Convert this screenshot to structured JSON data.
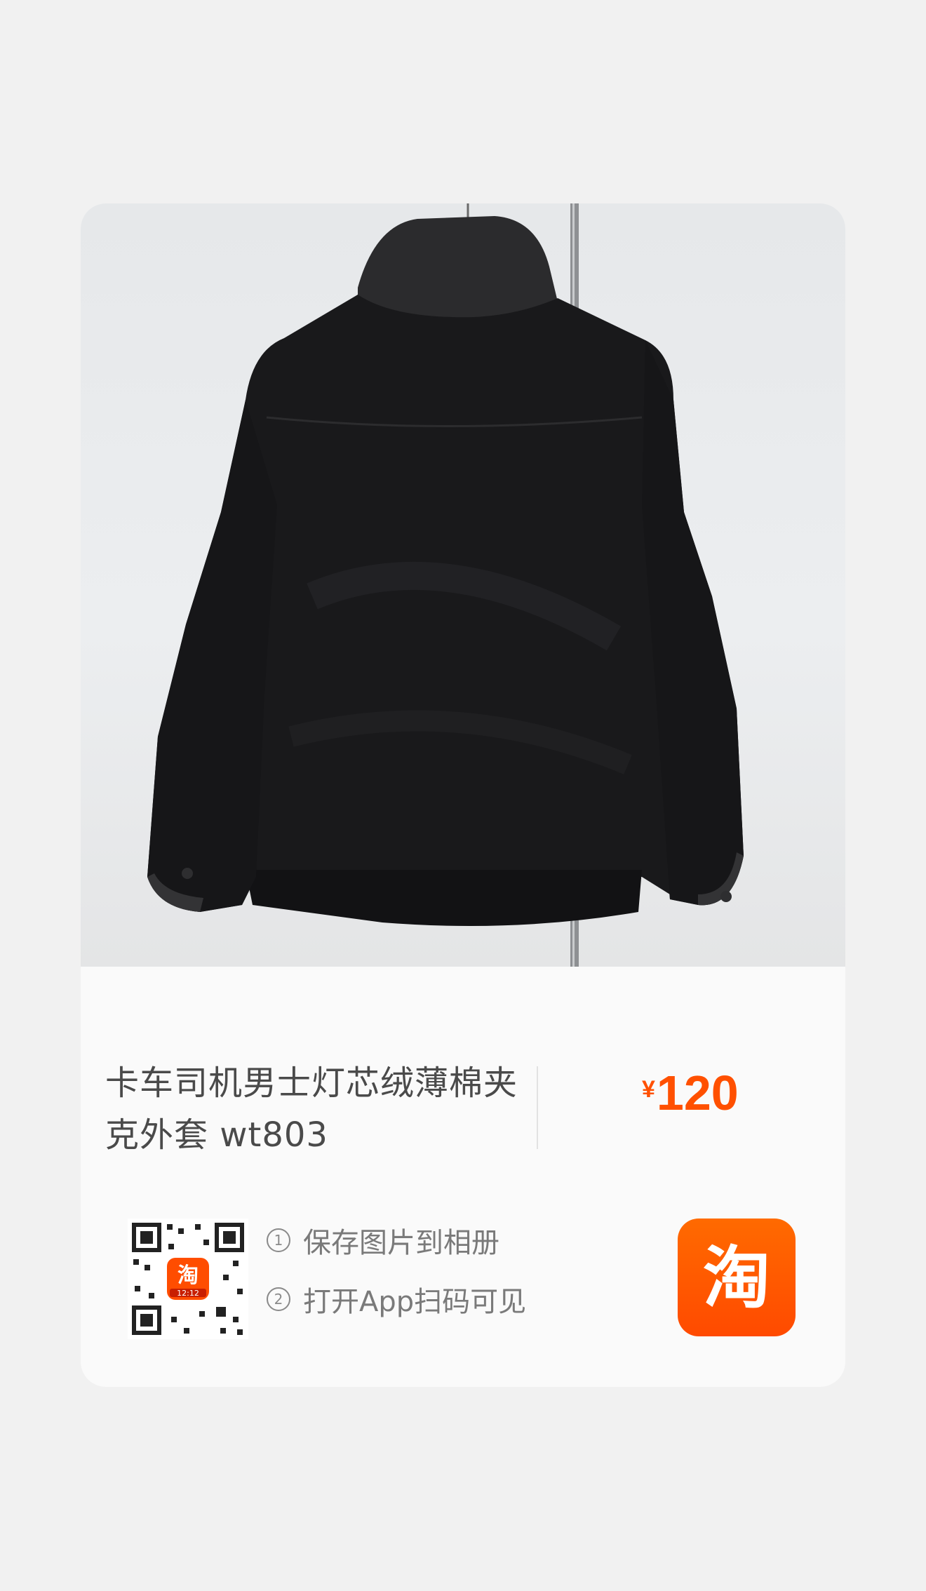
{
  "product": {
    "title": "卡车司机男士灯芯绒薄棉夹克外套 wt803",
    "currency": "¥",
    "price": "120"
  },
  "steps": [
    {
      "num": "1",
      "text": "保存图片到相册"
    },
    {
      "num": "2",
      "text": "打开App扫码可见"
    }
  ],
  "qr_badge_text": "12:12",
  "app_icon": {
    "name": "taobao-icon",
    "glyph": "淘"
  },
  "colors": {
    "accent": "#ff5000",
    "background": "#f1f1f1",
    "card": "#fafafa"
  }
}
